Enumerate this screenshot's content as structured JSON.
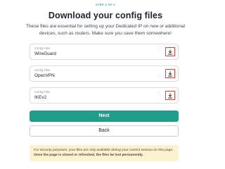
{
  "step": "STEP 2 OF 3",
  "title": "Download your config files",
  "description": "These files are essential for setting up your Dedicated IP on new or additional devices, such as routers. Make sure you save them somewhere!",
  "files": [
    {
      "label": "Config Files",
      "value": "WireGuard",
      "icon": "download-icon"
    },
    {
      "label": "Config Files",
      "value": "OpenVPN",
      "icon": "download-icon"
    },
    {
      "label": "Config Files",
      "value": "IKEv2",
      "icon": "download-icon"
    }
  ],
  "buttons": {
    "next_label": "Next",
    "back_label": "Back"
  },
  "notice": {
    "normal": "For security purposes, your files are only available during your current session on this page.",
    "bold": "Once the page is closed or refreshed, the files be lost permanently."
  },
  "colors": {
    "accent": "#1f9d8b",
    "highlight_border": "#e2452f",
    "notice_bg": "#fdf2cf"
  }
}
